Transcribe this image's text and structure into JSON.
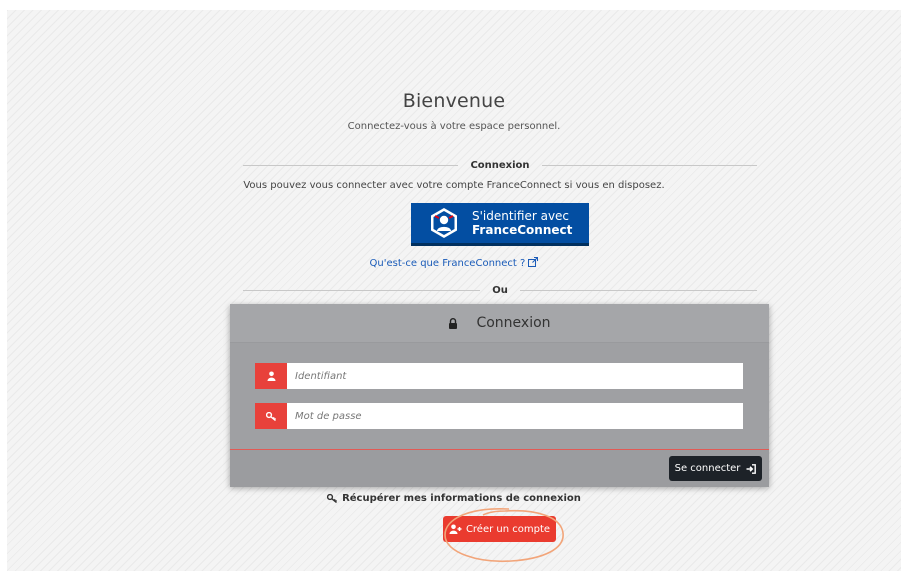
{
  "welcome": {
    "title": "Bienvenue",
    "subtitle": "Connectez-vous à votre espace personnel."
  },
  "franceconnect": {
    "divider_label": "Connexion",
    "info": "Vous pouvez vous connecter avec votre compte FranceConnect si vous en disposez.",
    "button_line1": "S'identifier avec",
    "button_line2": "FranceConnect",
    "what_link": "Qu'est-ce que FranceConnect ?",
    "button_color": "#034ea2"
  },
  "or_divider": "Ou",
  "login": {
    "header": "Connexion",
    "username_placeholder": "Identifiant",
    "password_placeholder": "Mot de passe",
    "submit_label": "Se connecter",
    "accent_color": "#e8413b"
  },
  "recover_link": "Récupérer mes informations de connexion",
  "create_account_label": "Créer un compte",
  "icons": {
    "lock": "lock-icon",
    "user": "user-icon",
    "key": "key-icon",
    "sign_in": "sign-in-icon",
    "external": "external-link-icon",
    "user_plus": "user-plus-icon"
  }
}
